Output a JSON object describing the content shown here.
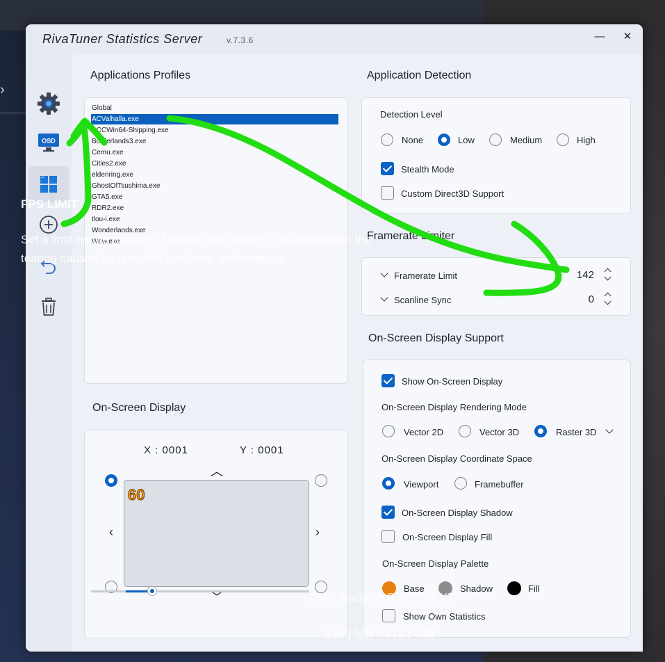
{
  "background": {
    "fps_limit": "FPS LIMIT",
    "description_line1": "Set a limit on the number of frames per second. This eliminates the",
    "description_line2": "tearing caused by unstable hardware performance.",
    "gpu_name": "AMD Radeon RX 5700 XT",
    "memory": "6393 MB / 8151 MB"
  },
  "window": {
    "title": "RivaTuner Statistics Server",
    "version": "v.7.3.6",
    "minimize": "—",
    "close": "✕"
  },
  "sidebar": {
    "items": [
      {
        "icon": "settings-gear-icon"
      },
      {
        "icon": "osd-monitor-icon",
        "label": "OSD"
      },
      {
        "icon": "windows-profiles-icon"
      },
      {
        "icon": "add-icon"
      },
      {
        "icon": "undo-icon"
      },
      {
        "icon": "trash-icon"
      }
    ]
  },
  "profiles": {
    "title": "Applications Profiles",
    "items": [
      "Global",
      "ACValhalla.exe",
      "ACCWin64-Shipping.exe",
      "Borderlands3.exe",
      "Cemu.exe",
      "Cities2.exe",
      "eldenring.exe",
      "GhostOfTsushima.exe",
      "GTA5.exe",
      "RDR2.exe",
      "tlou-i.exe",
      "Wonderlands.exe",
      "Wow.exe"
    ],
    "selected_index": 1
  },
  "detection": {
    "title": "Application Detection",
    "level_label": "Detection Level",
    "levels": [
      "None",
      "Low",
      "Medium",
      "High"
    ],
    "selected_level": "Low",
    "stealth_mode": "Stealth Mode",
    "custom_d3d": "Custom Direct3D Support"
  },
  "framerate": {
    "title": "Framerate Limiter",
    "limit_label": "Framerate Limit",
    "limit_value": "142",
    "scanline_label": "Scanline Sync",
    "scanline_value": "0"
  },
  "osd_panel": {
    "title": "On-Screen Display",
    "x_label": "X : 0001",
    "y_label": "Y : 0001",
    "fps_preview": "60",
    "slider_level": 0.28
  },
  "osd_support": {
    "title": "On-Screen Display Support",
    "show_osd": "Show On-Screen Display",
    "rendering_mode_label": "On-Screen Display Rendering Mode",
    "rendering_modes": [
      "Vector 2D",
      "Vector 3D",
      "Raster 3D"
    ],
    "selected_mode": "Raster 3D",
    "coord_space_label": "On-Screen Display Coordinate Space",
    "coord_spaces": [
      "Viewport",
      "Framebuffer"
    ],
    "selected_space": "Viewport",
    "shadow": "On-Screen Display Shadow",
    "fill": "On-Screen Display Fill",
    "palette_label": "On-Screen Display Palette",
    "palette": [
      {
        "name": "Base",
        "color": "#e8800e"
      },
      {
        "name": "Shadow",
        "color": "#8c8c8c"
      },
      {
        "name": "Fill",
        "color": "#000000"
      }
    ],
    "show_own_stats": "Show Own Statistics"
  },
  "colors": {
    "accent": "#0a62c4",
    "annotation": "#22dd11"
  }
}
